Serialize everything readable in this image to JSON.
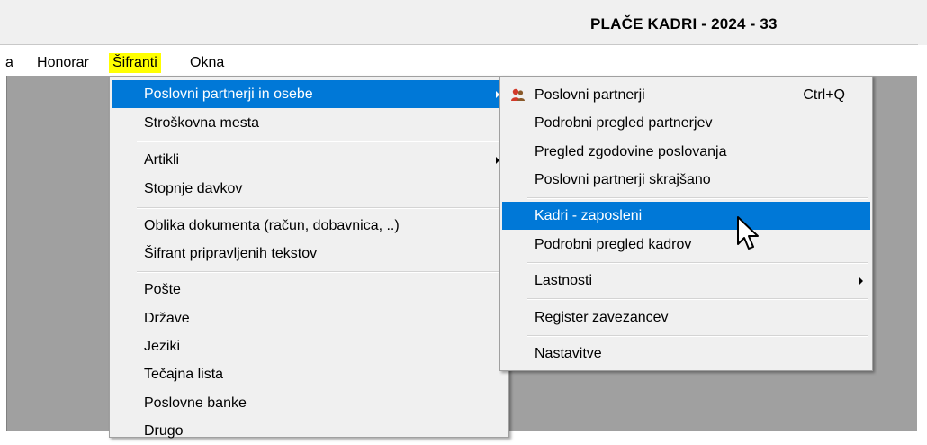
{
  "window": {
    "title": "PLAČE KADRI - 2024 - 33"
  },
  "menubar": {
    "items": [
      {
        "id": "a",
        "label": "a"
      },
      {
        "id": "honorar",
        "mnemonic": "H",
        "rest": "onorar"
      },
      {
        "id": "sifranti",
        "mnemonic": "Š",
        "rest": "ifranti"
      },
      {
        "id": "okna",
        "label": "Okna"
      }
    ]
  },
  "main_menu": {
    "items": [
      "Poslovni partnerji in osebe",
      "Stroškovna mesta",
      "Artikli",
      "Stopnje davkov",
      "Oblika dokumenta (račun, dobavnica, ..)",
      "Šifrant pripravljenih tekstov",
      "Pošte",
      "Države",
      "Jeziki",
      "Tečajna lista",
      "Poslovne banke",
      "Drugo"
    ]
  },
  "sub_menu": {
    "items": [
      "Poslovni partnerji",
      "Podrobni pregled partnerjev",
      "Pregled zgodovine poslovanja",
      "Poslovni partnerji skrajšano",
      "Kadri - zaposleni",
      "Podrobni pregled kadrov",
      "Lastnosti",
      "Register zavezancev",
      "Nastavitve"
    ],
    "shortcut": "Ctrl+Q",
    "icon": "partners-icon"
  },
  "colors": {
    "highlight": "#0078d7",
    "active_menu": "#ffff00",
    "workspace": "#a0a0a0",
    "menu_bg": "#f0f0f0"
  }
}
